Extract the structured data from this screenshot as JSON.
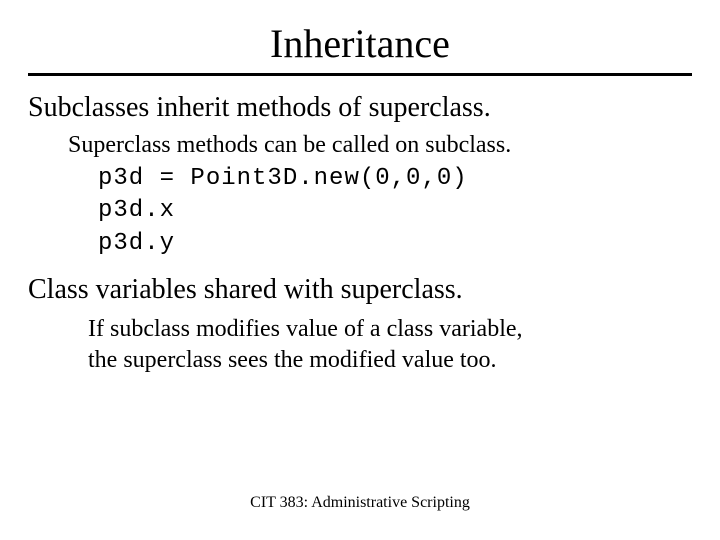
{
  "title": "Inheritance",
  "section1": {
    "heading": "Subclasses inherit methods of superclass.",
    "sub": "Superclass methods can be called on subclass.",
    "code": [
      "p3d = Point3D.new(0,0,0)",
      "p3d.x",
      "p3d.y"
    ]
  },
  "section2": {
    "heading": "Class variables shared with superclass.",
    "sub1": "If subclass modifies value of a class variable,",
    "sub2": "the superclass sees the modified value too."
  },
  "footer": "CIT 383: Administrative Scripting"
}
